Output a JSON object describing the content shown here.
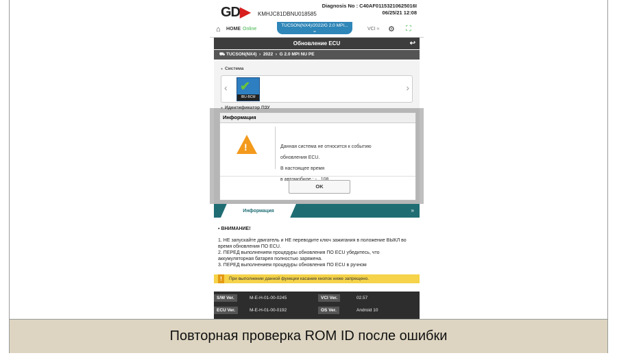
{
  "caption": "Повторная проверка ROM ID после ошибки",
  "header": {
    "logo": "GD",
    "vin": "KMHJC81DBNU018585",
    "diagnosis_line": "Diagnosis No : C40AF01153210625016I",
    "timestamp": "06/25/21 12:08"
  },
  "nav": {
    "home": "HOME",
    "status": "Online",
    "vehicle": "TUCSON(NX4)/2022/G 2.0 MPI...",
    "vci": "VCI"
  },
  "screen_title": "Обновление ECU",
  "breadcrumb": {
    "model": "TUCSON(NX4)",
    "year": "2022",
    "engine": "G 2.0 MPI NU PE"
  },
  "system": {
    "label": "Система",
    "ecu_name": "IBU-BCM"
  },
  "rom_label": "Идентификатор ПЗУ",
  "dialog": {
    "title": "Информация",
    "message_1": "Данная система не относится к событию",
    "message_2": "обновления ECU.",
    "message_3": "В настоящее время",
    "message_4": "в автомобиле :    -   _108",
    "ok": "OK"
  },
  "info_panel": {
    "tab": "Информация",
    "attention": "ВНИМАНИЕ!",
    "line_1": "1. НЕ запускайте двигатель и НЕ переводите ключ зажигания в положение ВЫКЛ во время обновления ПО ECU.",
    "line_2": "2. ПЕРЕД выполнением процедуры обновления ПО ECU убедитесь, что аккумуляторная батарея полностью заряжена.",
    "line_3": "3. ПЕРЕД выполнением процедуры обновления ПО ECU в ручном",
    "warning": "При выполнении данной функции касание кнопок ниже запрещено."
  },
  "versions": {
    "sw_label": "S/W Ver.",
    "sw_value": "M-E-H-01-00-0245",
    "vci_label": "VCI Ver.",
    "vci_value": "02.57",
    "ecu_label": "ECU Ver.",
    "ecu_value": "M-E-H-01-00-0192",
    "os_label": "OS Ver.",
    "os_value": "Android 10"
  },
  "colors": {
    "brand_red": "#d81e1e",
    "accent_blue": "#2f86b8",
    "teal": "#1f6d73",
    "warning_orange": "#f39a1d",
    "caption_band": "#ddd5c1"
  }
}
